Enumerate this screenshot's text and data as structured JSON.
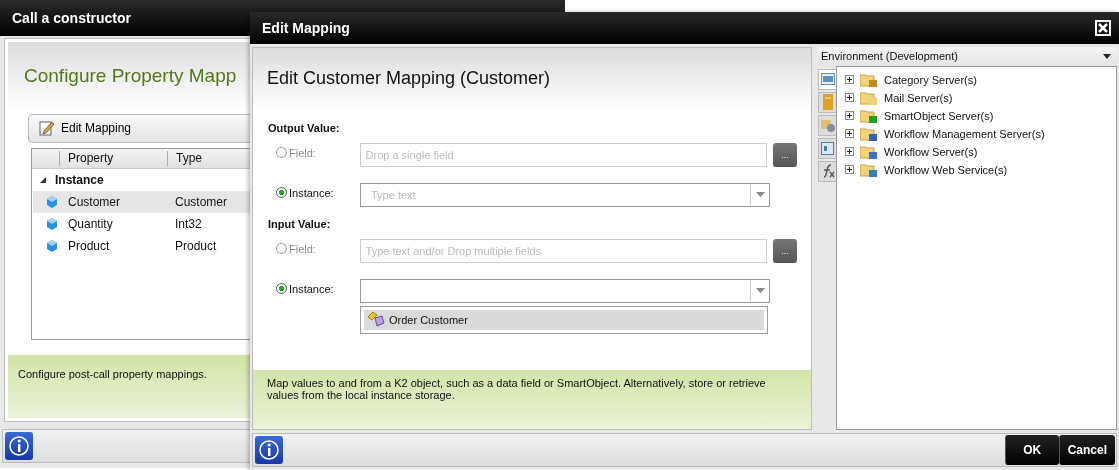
{
  "background_window": {
    "title": "Call a constructor",
    "heading": "Configure Property Mapp",
    "toolbar_button": "Edit Mapping",
    "grid": {
      "columns": [
        "Property",
        "Type"
      ],
      "groups": [
        {
          "label": "Instance",
          "expanded": true,
          "rows": [
            {
              "property": "Customer",
              "type": "Customer",
              "selected": true
            },
            {
              "property": "Quantity",
              "type": "Int32",
              "selected": false
            },
            {
              "property": "Product",
              "type": "Product",
              "selected": false
            }
          ]
        }
      ]
    },
    "info_text": "Configure post-call property mappings."
  },
  "dialog": {
    "title": "Edit Mapping",
    "heading": "Edit Customer Mapping (Customer)",
    "sections": [
      {
        "label": "Output Value:",
        "options": [
          {
            "kind": "field",
            "label": "Field:",
            "selected": false,
            "placeholder": "Drop a single field",
            "browse": "..."
          },
          {
            "kind": "dropdown",
            "label": "Instance:",
            "selected": true,
            "placeholder": "Type text"
          }
        ]
      },
      {
        "label": "Input Value:",
        "options": [
          {
            "kind": "field",
            "label": "Field:",
            "selected": false,
            "placeholder": "Type text and/or Drop multiple fields",
            "browse": "..."
          },
          {
            "kind": "dropdown",
            "label": "Instance:",
            "selected": true,
            "items": [
              {
                "label": "Order Customer",
                "selected": true
              }
            ]
          }
        ]
      }
    ],
    "info_text": "Map values to and from a K2 object, such as a data field or SmartObject. Alternatively, store or retrieve values from the local instance storage.",
    "buttons": [
      "OK",
      "Cancel"
    ]
  },
  "environment": {
    "title": "Environment (Development)",
    "side_tabs": [
      {
        "kind": "image",
        "selected": true
      },
      {
        "kind": "notebook",
        "selected": false
      },
      {
        "kind": "servers",
        "selected": false
      },
      {
        "kind": "form",
        "selected": false
      },
      {
        "kind": "function",
        "selected": false
      }
    ],
    "tree": [
      {
        "kind": "category",
        "label": "Category Server(s)",
        "expanded": false
      },
      {
        "kind": "mail",
        "label": "Mail Server(s)",
        "expanded": false
      },
      {
        "kind": "smartobject",
        "label": "SmartObject Server(s)",
        "expanded": false
      },
      {
        "kind": "management",
        "label": "Workflow Management Server(s)",
        "expanded": false
      },
      {
        "kind": "workflow",
        "label": "Workflow Server(s)",
        "expanded": false
      },
      {
        "kind": "webservice",
        "label": "Workflow Web Service(s)",
        "expanded": false
      }
    ]
  }
}
